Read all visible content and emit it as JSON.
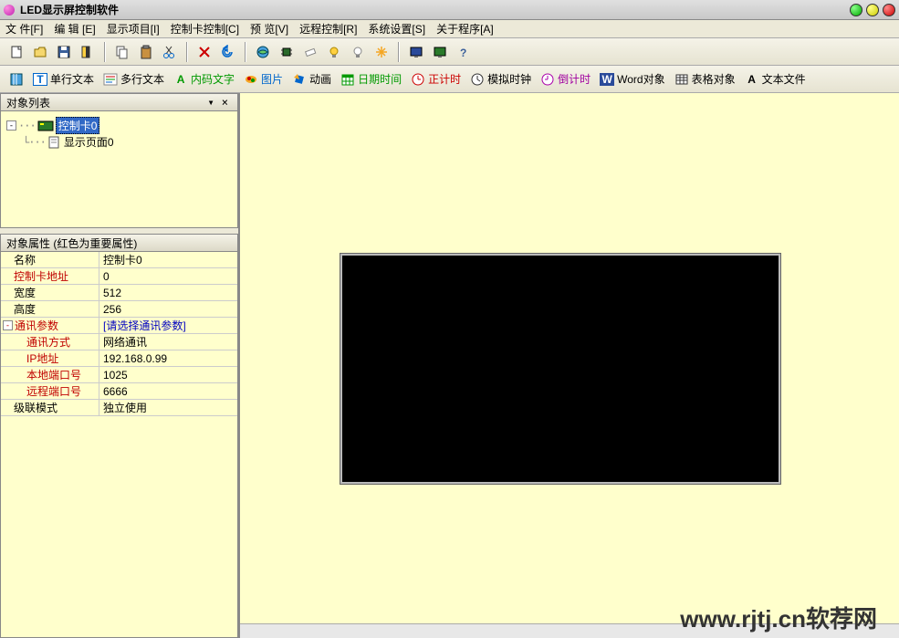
{
  "window": {
    "title": "LED显示屏控制软件"
  },
  "menu": {
    "file": "文 件[F]",
    "edit": "编 辑 [E]",
    "project": "显示项目[I]",
    "card": "控制卡控制[C]",
    "preview": "预 览[V]",
    "remote": "远程控制[R]",
    "system": "系统设置[S]",
    "about": "关于程序[A]"
  },
  "toolbar2": {
    "single_line": "单行文本",
    "multi_line": "多行文本",
    "inner_text": "内码文字",
    "picture": "图片",
    "animation": "动画",
    "datetime": "日期时间",
    "count_up": "正计时",
    "analog_clock": "模拟时钟",
    "count_down": "倒计时",
    "word_obj": "Word对象",
    "table_obj": "表格对象",
    "text_file": "文本文件"
  },
  "panels": {
    "object_list": "对象列表",
    "object_props": "对象属性 (红色为重要属性)"
  },
  "tree": {
    "root": "控制卡0",
    "page": "显示页面0"
  },
  "props": {
    "name_k": "名称",
    "name_v": "控制卡0",
    "addr_k": "控制卡地址",
    "addr_v": "0",
    "width_k": "宽度",
    "width_v": "512",
    "height_k": "高度",
    "height_v": "256",
    "comm_k": "通讯参数",
    "comm_v": "[请选择通讯参数]",
    "method_k": "通讯方式",
    "method_v": "网络通讯",
    "ip_k": "IP地址",
    "ip_v": "192.168.0.99",
    "lport_k": "本地端口号",
    "lport_v": "1025",
    "rport_k": "远程端口号",
    "rport_v": "6666",
    "cascade_k": "级联模式",
    "cascade_v": "独立使用"
  },
  "watermark": "www.rjtj.cn软荐网"
}
